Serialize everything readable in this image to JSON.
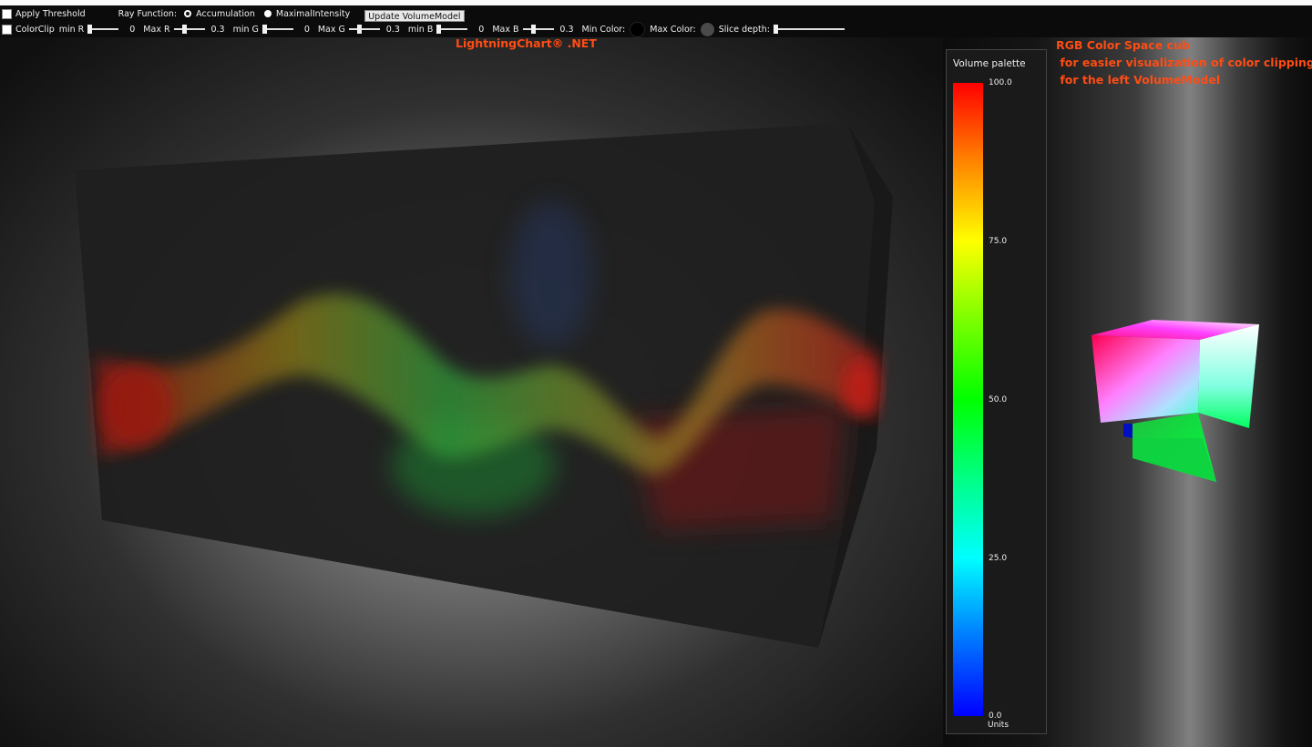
{
  "toolbar": {
    "apply_threshold": "Apply Threshold",
    "ray_function_label": "Ray Function:",
    "ray_options": [
      "Accumulation",
      "MaximalIntensity"
    ],
    "ray_selected": "Accumulation",
    "update_button": "Update VolumeModel",
    "colorclip": "ColorClip",
    "sliders": [
      {
        "label": "min R",
        "value": "0"
      },
      {
        "label": "Max R",
        "value": "0.3"
      },
      {
        "label": "min G",
        "value": "0"
      },
      {
        "label": "Max G",
        "value": "0.3"
      },
      {
        "label": "min B",
        "value": "0"
      },
      {
        "label": "Max B",
        "value": "0.3"
      }
    ],
    "min_color_label": "Min Color:",
    "max_color_label": "Max Color:",
    "min_color": "#000000",
    "max_color": "#4a4a4a",
    "slice_depth_label": "Slice depth:"
  },
  "brand": "LightningChart® .NET",
  "cube_title": {
    "line1": "RGB Color Space cub",
    "line2": " for easier visualization of color clipping",
    "line3": " for the left VolumeModel"
  },
  "palette": {
    "title": "Volume palette",
    "ticks": [
      "100.0",
      "75.0",
      "50.0",
      "25.0",
      "0.0"
    ],
    "units": "Units"
  },
  "colors": {
    "accent": "#ff4c14",
    "palette_max": "#ff0000",
    "palette_min": "#0000ff"
  },
  "icons": {
    "checkbox": "checkbox-icon",
    "radio": "radio-icon"
  }
}
